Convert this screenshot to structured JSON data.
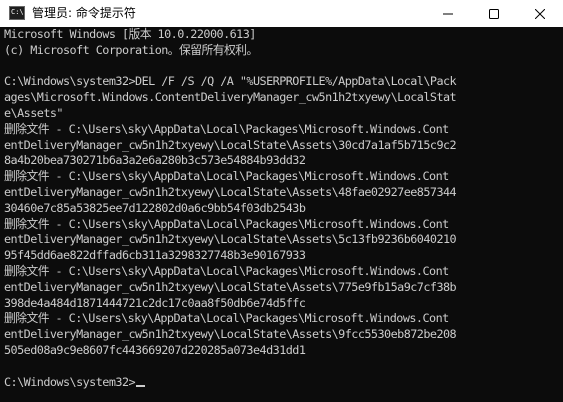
{
  "window": {
    "title": "管理员: 命令提示符",
    "icon_name": "cmd-icon",
    "icon_text": "C:\\",
    "minimize_icon": "minimize-icon",
    "maximize_icon": "maximize-icon",
    "close_icon": "close-icon"
  },
  "console": {
    "lines": [
      "Microsoft Windows [版本 10.0.22000.613]",
      "(c) Microsoft Corporation。保留所有权利。",
      "",
      "C:\\Windows\\system32>DEL /F /S /Q /A \"%USERPROFILE%/AppData\\Local\\Pack",
      "ages\\Microsoft.Windows.ContentDeliveryManager_cw5n1h2txyewy\\LocalStat",
      "e\\Assets\"",
      "删除文件 - C:\\Users\\sky\\AppData\\Local\\Packages\\Microsoft.Windows.Cont",
      "entDeliveryManager_cw5n1h2txyewy\\LocalState\\Assets\\30cd7a1af5b715c9c2",
      "8a4b20bea730271b6a3a2e6a280b3c573e54884b93dd32",
      "删除文件 - C:\\Users\\sky\\AppData\\Local\\Packages\\Microsoft.Windows.Cont",
      "entDeliveryManager_cw5n1h2txyewy\\LocalState\\Assets\\48fae02927ee857344",
      "30460e7c85a53825ee7d122802d0a6c9bb54f03db2543b",
      "删除文件 - C:\\Users\\sky\\AppData\\Local\\Packages\\Microsoft.Windows.Cont",
      "entDeliveryManager_cw5n1h2txyewy\\LocalState\\Assets\\5c13fb9236b6040210",
      "95f45dd6ae822dffad6cb311a3298327748b3e90167933",
      "删除文件 - C:\\Users\\sky\\AppData\\Local\\Packages\\Microsoft.Windows.Cont",
      "entDeliveryManager_cw5n1h2txyewy\\LocalState\\Assets\\775e9fb15a9c7cf38b",
      "398de4a484d1871444721c2dc17c0aa8f50db6e74d5ffc",
      "删除文件 - C:\\Users\\sky\\AppData\\Local\\Packages\\Microsoft.Windows.Cont",
      "entDeliveryManager_cw5n1h2txyewy\\LocalState\\Assets\\9fcc5530eb872be208",
      "505ed08a9c9e8607fc443669207d220285a073e4d31dd1",
      "",
      "C:\\Windows\\system32>"
    ]
  },
  "colors": {
    "background": "#0c0c0c",
    "text": "#cccccc",
    "titlebar": "#ffffff"
  }
}
